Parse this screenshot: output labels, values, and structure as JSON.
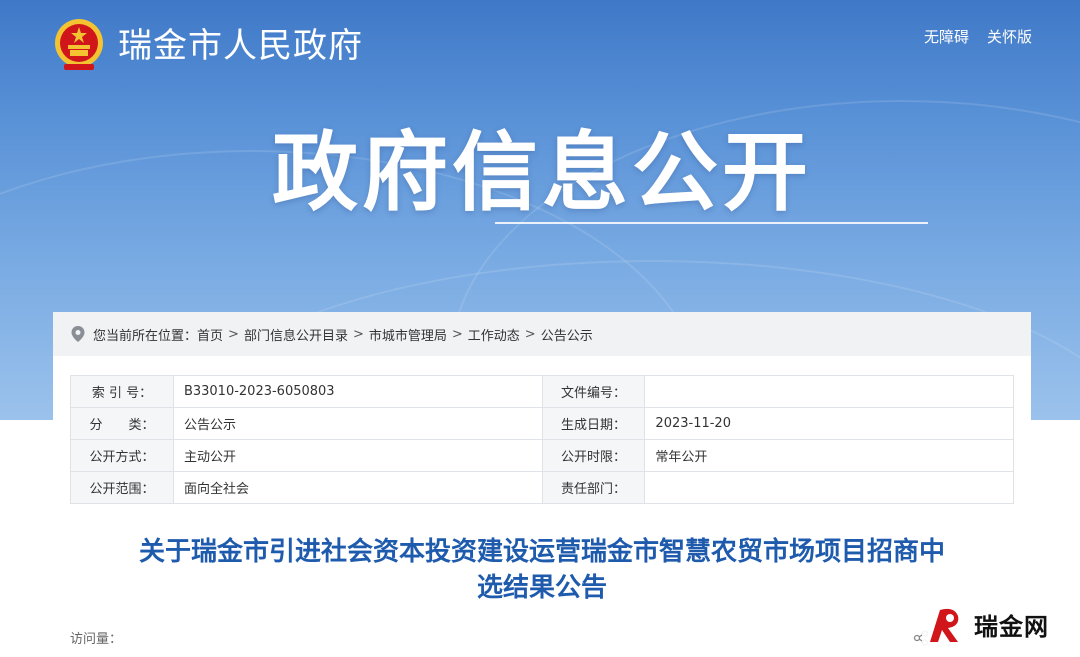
{
  "header": {
    "site_title": "瑞金市人民政府",
    "links": [
      "无障碍",
      "关怀版"
    ]
  },
  "hero": {
    "title": "政府信息公开"
  },
  "breadcrumb": {
    "label": "您当前所在位置：",
    "items": [
      "首页",
      "部门信息公开目录",
      "市城市管理局",
      "工作动态",
      "公告公示"
    ],
    "separator": ">"
  },
  "meta_table": {
    "rows": [
      {
        "label_left": "索 引 号：",
        "value_left": "B33010-2023-6050803",
        "label_right": "文件编号：",
        "value_right": ""
      },
      {
        "label_left": "分　　类：",
        "value_left": "公告公示",
        "label_right": "生成日期：",
        "value_right": "2023-11-20"
      },
      {
        "label_left": "公开方式：",
        "value_left": "主动公开",
        "label_right": "公开时限：",
        "value_right": "常年公开"
      },
      {
        "label_left": "公开范围：",
        "value_left": "面向全社会",
        "label_right": "责任部门：",
        "value_right": ""
      }
    ]
  },
  "document": {
    "title_line1": "关于瑞金市引进社会资本投资建设运营瑞金市智慧农贸市场项目招商中",
    "title_line2": "选结果公告",
    "visits_label": "访问量："
  },
  "watermark": {
    "text": "瑞金网"
  },
  "colors": {
    "hero_top": "#3f78c7",
    "title_blue": "#1f5bad",
    "emblem_red": "#d0161b",
    "emblem_gold": "#f3c332"
  },
  "icons": [
    "national-emblem-icon",
    "location-pin-icon",
    "watermark-logo-icon",
    "share-icon"
  ]
}
